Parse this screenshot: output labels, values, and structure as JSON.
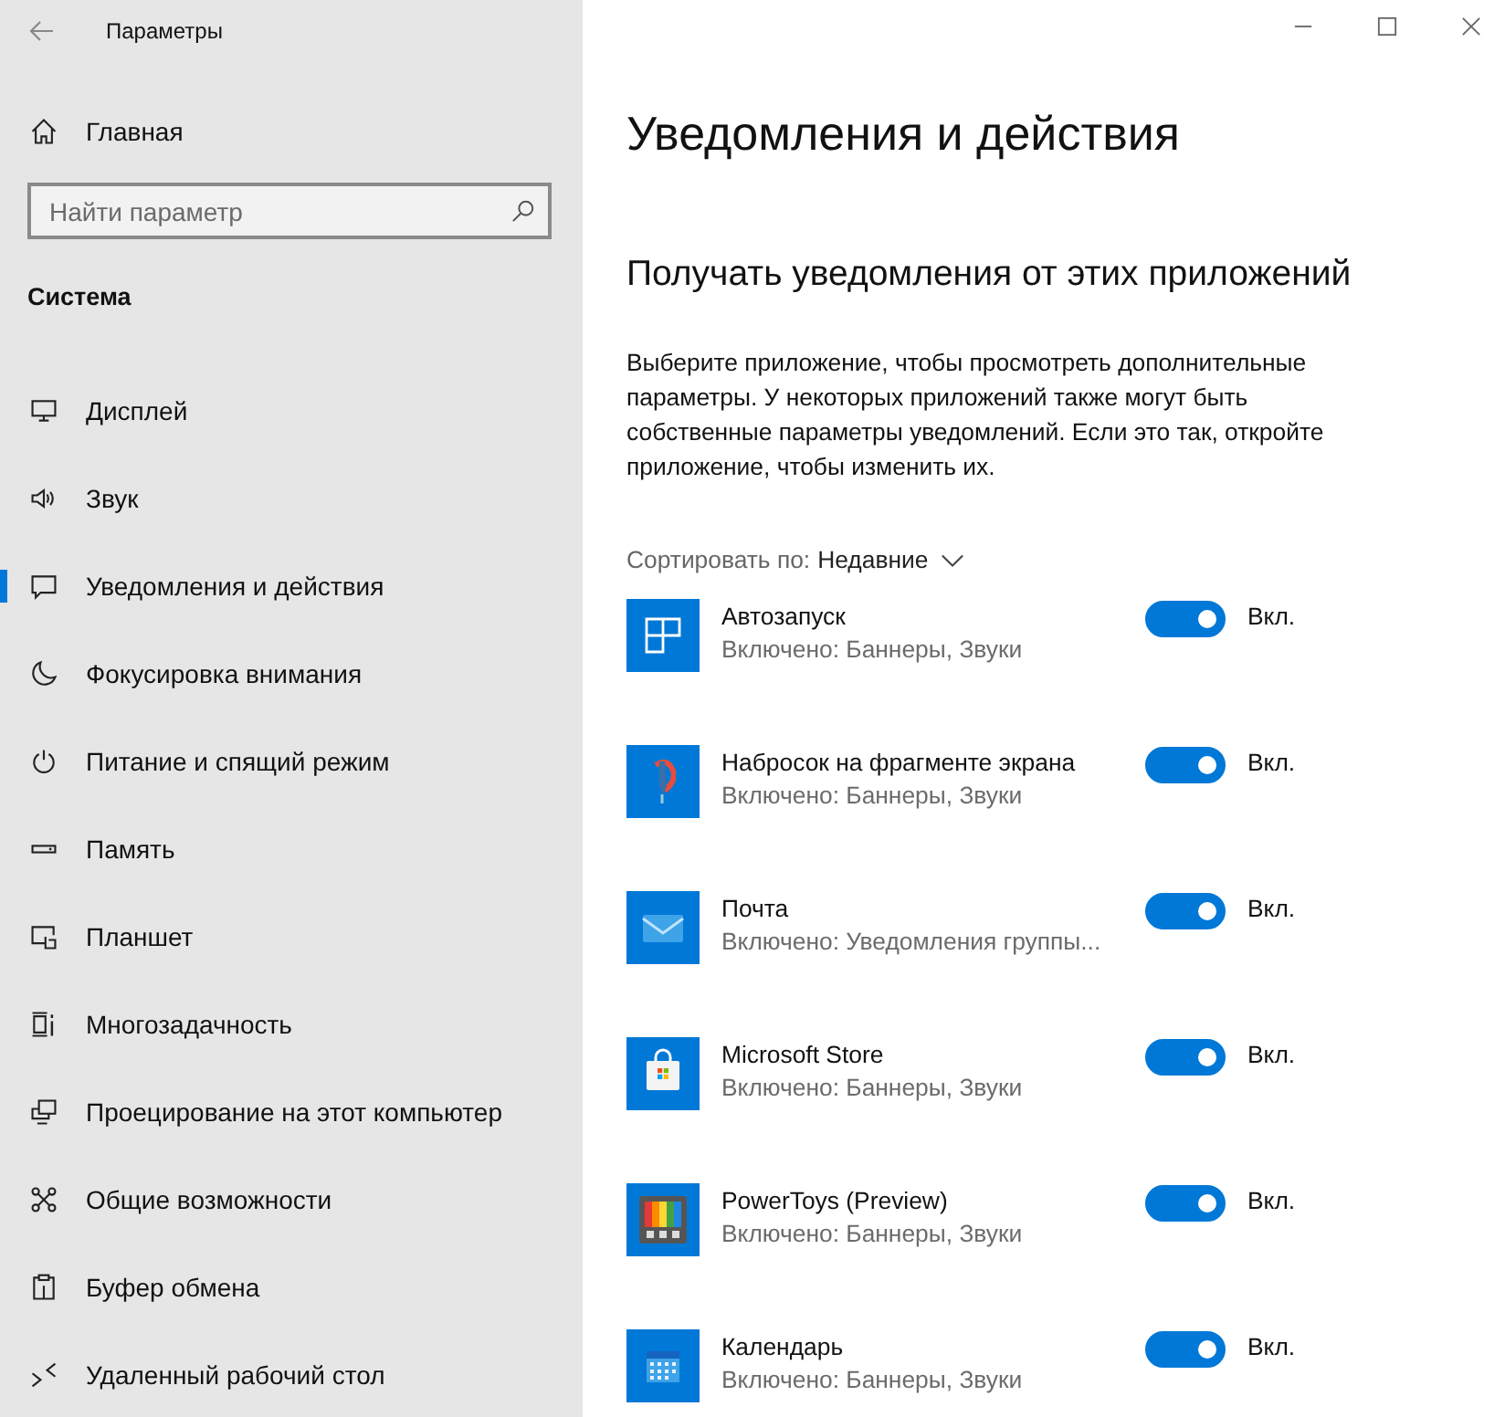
{
  "window": {
    "title": "Параметры"
  },
  "sidebar": {
    "home": "Главная",
    "search": {
      "placeholder": "Найти параметр"
    },
    "section": "Система",
    "items": [
      {
        "label": "Дисплей",
        "selected": false
      },
      {
        "label": "Звук",
        "selected": false
      },
      {
        "label": "Уведомления и действия",
        "selected": true
      },
      {
        "label": "Фокусировка внимания",
        "selected": false
      },
      {
        "label": "Питание и спящий режим",
        "selected": false
      },
      {
        "label": "Память",
        "selected": false
      },
      {
        "label": "Планшет",
        "selected": false
      },
      {
        "label": "Многозадачность",
        "selected": false
      },
      {
        "label": "Проецирование на этот компьютер",
        "selected": false
      },
      {
        "label": "Общие возможности",
        "selected": false
      },
      {
        "label": "Буфер обмена",
        "selected": false
      },
      {
        "label": "Удаленный рабочий стол",
        "selected": false
      }
    ]
  },
  "page": {
    "title": "Уведомления и действия",
    "subtitle": "Получать уведомления от этих приложений",
    "description": "Выберите приложение, чтобы просмотреть дополнительные параметры. У некоторых приложений также могут быть собственные параметры уведомлений. Если это так, откройте приложение, чтобы изменить их.",
    "sort_label": "Сортировать по:",
    "sort_value": "Недавние",
    "apps": [
      {
        "name": "Автозапуск",
        "detail": "Включено: Баннеры, Звуки",
        "on": true,
        "state": "Вкл."
      },
      {
        "name": "Набросок на фрагменте экрана",
        "detail": "Включено: Баннеры, Звуки",
        "on": true,
        "state": "Вкл."
      },
      {
        "name": "Почта",
        "detail": "Включено: Уведомления группы...",
        "on": true,
        "state": "Вкл."
      },
      {
        "name": "Microsoft Store",
        "detail": "Включено: Баннеры, Звуки",
        "on": true,
        "state": "Вкл."
      },
      {
        "name": "PowerToys (Preview)",
        "detail": "Включено: Баннеры, Звуки",
        "on": true,
        "state": "Вкл."
      },
      {
        "name": "Календарь",
        "detail": "Включено: Баннеры, Звуки",
        "on": true,
        "state": "Вкл."
      }
    ]
  }
}
